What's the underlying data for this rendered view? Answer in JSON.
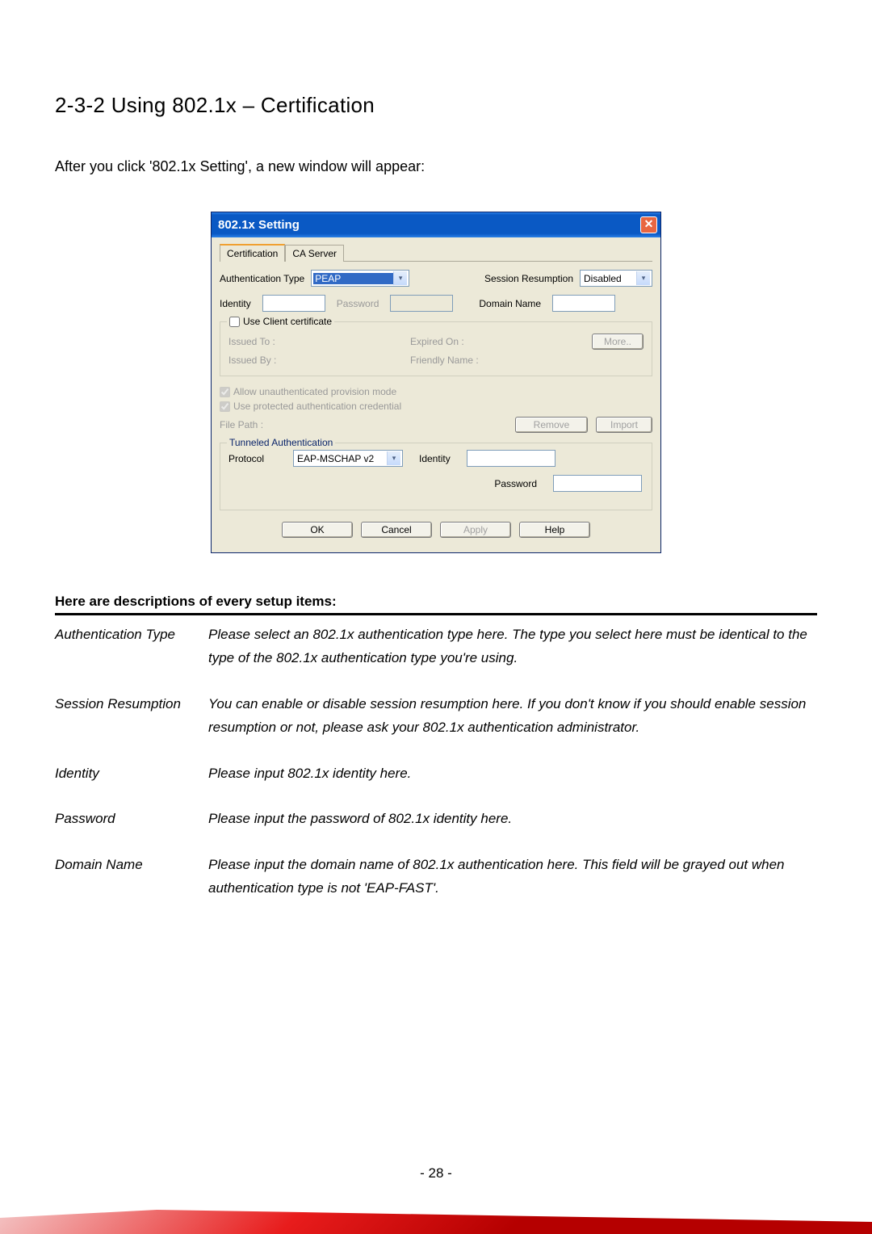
{
  "heading": "2-3-2 Using 802.1x – Certification",
  "intro": "After you click '802.1x Setting', a new window will appear:",
  "dialog": {
    "title": "802.1x Setting",
    "tabs": {
      "certification": "Certification",
      "ca_server": "CA Server"
    },
    "labels": {
      "auth_type": "Authentication Type",
      "session_resumption": "Session Resumption",
      "identity": "Identity",
      "password": "Password",
      "domain_name": "Domain Name"
    },
    "values": {
      "auth_type": "PEAP",
      "session_resumption": "Disabled",
      "identity": "",
      "password": "",
      "domain_name": ""
    },
    "client_cert": {
      "use_client_cert": "Use Client certificate",
      "issued_to": "Issued To :",
      "issued_by": "Issued By :",
      "expired_on": "Expired On :",
      "friendly_name": "Friendly Name :",
      "more": "More.."
    },
    "provision": {
      "allow_unauth": "Allow unauthenticated provision mode",
      "use_protected": "Use protected authentication credential",
      "file_path": "File Path :",
      "remove": "Remove",
      "import": "Import"
    },
    "tunneled": {
      "title": "Tunneled Authentication",
      "protocol_label": "Protocol",
      "protocol_value": "EAP-MSCHAP v2",
      "identity_label": "Identity",
      "identity_value": "",
      "password_label": "Password",
      "password_value": ""
    },
    "buttons": {
      "ok": "OK",
      "cancel": "Cancel",
      "apply": "Apply",
      "help": "Help"
    }
  },
  "descriptions": {
    "header": "Here are descriptions of every setup items:",
    "items": [
      {
        "name": "Authentication Type",
        "text": "Please select an 802.1x authentication type here. The type you select here must be identical to the type of the 802.1x authentication type you're using."
      },
      {
        "name": "Session Resumption",
        "text": "You can enable or disable session resumption here. If you don't know if you should enable session resumption or not, please ask your 802.1x authentication administrator."
      },
      {
        "name": "Identity",
        "text": "Please input 802.1x identity here."
      },
      {
        "name": "Password",
        "text": "Please input the password of 802.1x identity here."
      },
      {
        "name": "Domain Name",
        "text": "Please input the domain name of 802.1x authentication here. This field will be grayed out when authentication type is not 'EAP-FAST'."
      }
    ]
  },
  "page_number": "- 28 -"
}
